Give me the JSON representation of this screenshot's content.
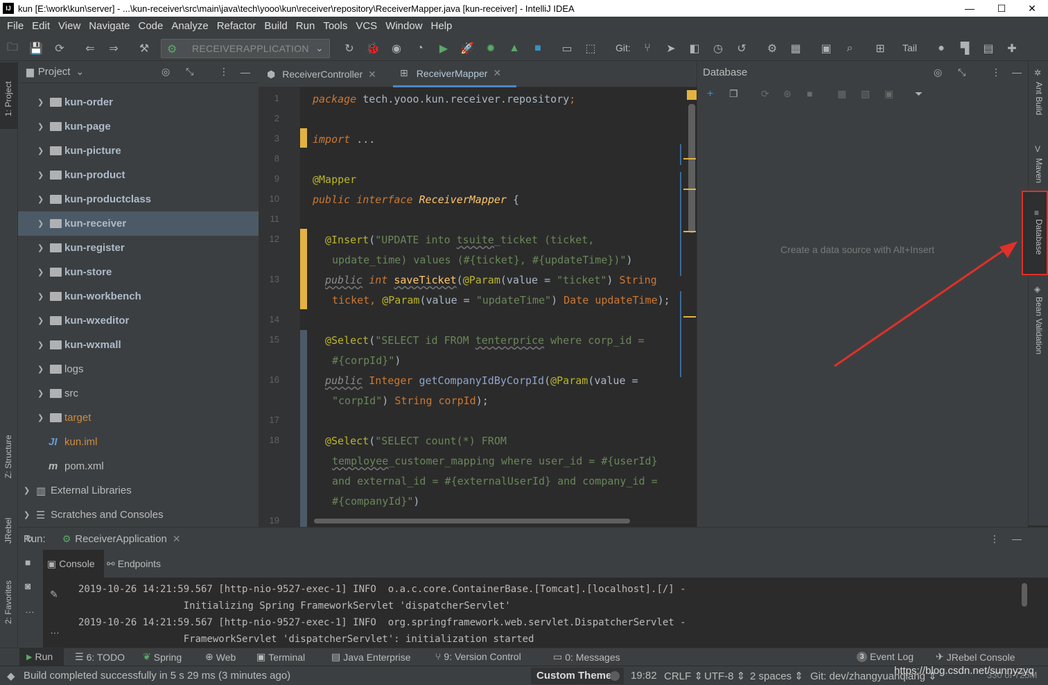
{
  "window": {
    "title": "kun [E:\\work\\kun\\server] - ...\\kun-receiver\\src\\main\\java\\tech\\yooo\\kun\\receiver\\repository\\ReceiverMapper.java [kun-receiver] - IntelliJ IDEA",
    "app_icon_text": "IJ",
    "minimize": "—",
    "maximize": "☐",
    "close": "✕"
  },
  "menu": [
    "File",
    "Edit",
    "View",
    "Navigate",
    "Code",
    "Analyze",
    "Refactor",
    "Build",
    "Run",
    "Tools",
    "VCS",
    "Window",
    "Help"
  ],
  "toolbar": {
    "run_configuration": "RECEIVERAPPLICATION",
    "git_label": "Git:",
    "tail_label": "Tail"
  },
  "left_strip": {
    "project": "1: Project",
    "structure": "Z: Structure",
    "jrebel": "JRebel",
    "favorites": "2: Favorites"
  },
  "project_panel": {
    "title": "Project",
    "items": [
      {
        "label": "kun-order",
        "type": "module"
      },
      {
        "label": "kun-page",
        "type": "module"
      },
      {
        "label": "kun-picture",
        "type": "module"
      },
      {
        "label": "kun-product",
        "type": "module"
      },
      {
        "label": "kun-productclass",
        "type": "module"
      },
      {
        "label": "kun-receiver",
        "type": "module",
        "selected": true
      },
      {
        "label": "kun-register",
        "type": "module"
      },
      {
        "label": "kun-store",
        "type": "module"
      },
      {
        "label": "kun-workbench",
        "type": "module"
      },
      {
        "label": "kun-wxeditor",
        "type": "module"
      },
      {
        "label": "kun-wxmall",
        "type": "module"
      },
      {
        "label": "logs",
        "type": "folder-plain"
      },
      {
        "label": "src",
        "type": "folder-plain"
      },
      {
        "label": "target",
        "type": "folder-orange"
      },
      {
        "label": "kun.iml",
        "type": "file-orange"
      },
      {
        "label": "pom.xml",
        "type": "file-plain"
      }
    ],
    "external_libraries": "External Libraries",
    "scratches": "Scratches and Consoles"
  },
  "editor": {
    "tabs": [
      {
        "label": "ReceiverController",
        "active": false
      },
      {
        "label": "ReceiverMapper",
        "active": true
      }
    ],
    "line_numbers": [
      "1",
      "2",
      "3",
      "8",
      "9",
      "10",
      "11",
      "12",
      "13",
      "14",
      "15",
      "16",
      "17",
      "18",
      "19"
    ],
    "code": {
      "package_kw": "package",
      "package_name": "tech.yooo.kun.receiver.repository",
      "package_semicolon": ";",
      "import_kw": "import",
      "import_dots": "...",
      "mapper_ann": "@Mapper",
      "public_kw": "public",
      "interface_kw": "interface",
      "class_name": "ReceiverMapper",
      "brace": "{",
      "insert_ann": "@Insert",
      "insert_s1a": "\"UPDATE into ",
      "insert_s1b": "tsuite",
      "insert_s1c": "_ticket (ticket,",
      "insert_s2": "update_time) values (#{ticket}, #{updateTime})\"",
      "close_paren": ")",
      "open_paren": "(",
      "int_kw": "int",
      "save_method": "saveTicket",
      "param_ann": "@Param",
      "value_eq": "value = ",
      "ticket_str": "\"ticket\"",
      "string_type": "String",
      "ticket_var": "ticket, ",
      "updatetime_str": "\"updateTime\"",
      "date_type": "Date",
      "updatetime_var": "updateTime",
      "end_stmt": ");",
      "select_ann": "@Select",
      "sel1a": "\"SELECT id FROM ",
      "sel1b": "tenterprice",
      "sel1c": " where corp_id =",
      "sel1d": "#{corpId}\"",
      "integer_type": "Integer",
      "getcompany_method": "getCompanyIdByCorpId",
      "corpid_str": "\"corpId\"",
      "corpid_var": "corpId",
      "sel2a": "\"SELECT count(*) FROM",
      "sel2b": "temployee",
      "sel2c": "_customer_mapping where user_id = #{userId}",
      "sel2d": "and external_id = #{externalUserId} and company_id =",
      "sel2e": "#{companyId}\""
    }
  },
  "database_panel": {
    "title": "Database",
    "empty_hint": "Create a data source with Alt+Insert"
  },
  "right_strip": {
    "ant_build": "Ant Build",
    "maven": "Maven",
    "database": "Database",
    "bean_validation": "Bean Validation"
  },
  "run_panel": {
    "label": "Run:",
    "tab": "ReceiverApplication",
    "subtabs": [
      "Console",
      "Endpoints"
    ],
    "log": [
      "2019-10-26 14:21:59.567 [http-nio-9527-exec-1] INFO  o.a.c.core.ContainerBase.[Tomcat].[localhost].[/] -",
      "                  Initializing Spring FrameworkServlet 'dispatcherServlet'",
      "2019-10-26 14:21:59.567 [http-nio-9527-exec-1] INFO  org.springframework.web.servlet.DispatcherServlet -",
      "                  FrameworkServlet 'dispatcherServlet': initialization started"
    ]
  },
  "bottom_tools": {
    "run": "Run",
    "todo": "6: TODO",
    "spring": "Spring",
    "web": "Web",
    "terminal": "Terminal",
    "java_enterprise": "Java Enterprise",
    "version_control": "9: Version Control",
    "messages": "0: Messages",
    "event_log": "Event Log",
    "event_log_count": "3",
    "jrebel_console": "JRebel Console"
  },
  "status_bar": {
    "message": "Build completed successfully in 5 s 29 ms (3 minutes ago)",
    "theme": "Custom Theme",
    "position": "19:82",
    "line_sep": "CRLF ⇕",
    "encoding": "UTF-8 ⇕",
    "indent": "2 spaces ⇕",
    "git_branch": "Git: dev/zhangyuanqiang ⇕",
    "memory": "330 of 725M",
    "watermark": "https://blog.csdn.net/sunnyzyq"
  },
  "colors": {
    "highlight_box": "#e0302a",
    "arrow": "#e0302a",
    "selection": "#4b5a66",
    "change_marker": "#e3b341"
  }
}
